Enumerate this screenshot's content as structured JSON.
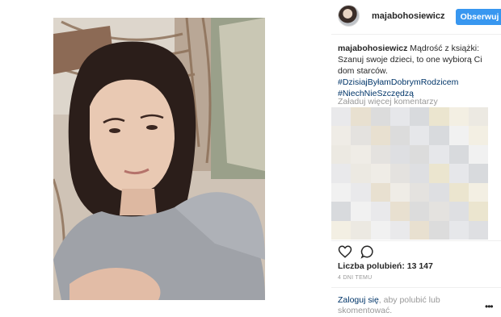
{
  "post": {
    "username": "majabohosiewicz",
    "follow_label": "Obserwuj",
    "caption": {
      "user": "majabohosiewicz",
      "text_line1": "Mądrość z książki:",
      "text_line2": "Szanuj swoje dzieci, to one wybiorą Ci",
      "text_line3": "dom starców.",
      "hashtags": [
        "#DzisiajByłamDobrymRodzicem",
        "#NiechNieSzczędzą"
      ]
    },
    "load_more_label": "Załaduj więcej komentarzy",
    "likes_text": "Liczba polubień: 13 147",
    "time_text": "4 DNI TEMU",
    "login_link": "Zaloguj się",
    "login_rest": ", aby polubić lub skomentować.",
    "more_icon": "ellipsis-icon",
    "like_icon": "heart-icon",
    "comment_icon": "comment-icon"
  },
  "colors": {
    "follow_button": "#3897f0",
    "link": "#003569",
    "muted": "#999999",
    "text": "#262626"
  }
}
